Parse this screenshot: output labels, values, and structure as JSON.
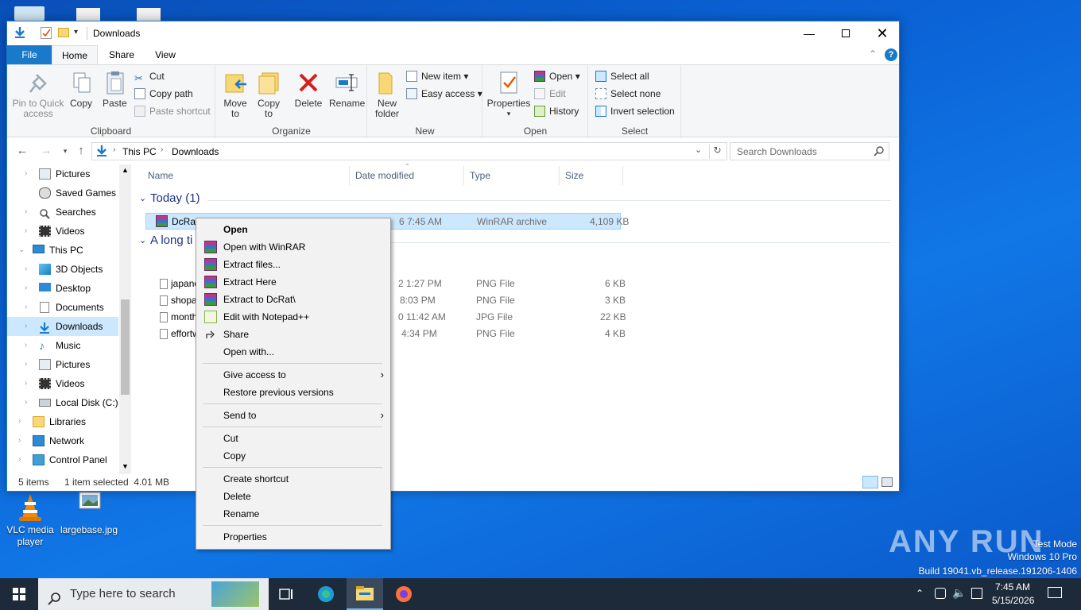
{
  "window": {
    "title": "Downloads",
    "tabs": [
      "File",
      "Home",
      "Share",
      "View"
    ]
  },
  "ribbon": {
    "clipboard": {
      "label": "Clipboard",
      "pin": "Pin to Quick access",
      "pin_l1": "Pin to Quick",
      "pin_l2": "access",
      "copy": "Copy",
      "paste": "Paste",
      "cut": "Cut",
      "copy_path": "Copy path",
      "paste_shortcut": "Paste shortcut"
    },
    "organize": {
      "label": "Organize",
      "move_to_l1": "Move",
      "move_to_l2": "to",
      "copy_to_l1": "Copy",
      "copy_to_l2": "to",
      "delete": "Delete",
      "rename": "Rename"
    },
    "new": {
      "label": "New",
      "new_folder_l1": "New",
      "new_folder_l2": "folder",
      "new_item": "New item",
      "easy_access": "Easy access"
    },
    "open": {
      "label": "Open",
      "properties": "Properties",
      "open": "Open",
      "edit": "Edit",
      "history": "History"
    },
    "select": {
      "label": "Select",
      "select_all": "Select all",
      "select_none": "Select none",
      "invert": "Invert selection"
    }
  },
  "address": {
    "crumbs": [
      "This PC",
      "Downloads"
    ],
    "search_placeholder": "Search Downloads"
  },
  "nav": [
    {
      "label": "Pictures",
      "icon": "pictures-icon"
    },
    {
      "label": "Saved Games",
      "icon": "saved-games-icon"
    },
    {
      "label": "Searches",
      "icon": "searches-icon"
    },
    {
      "label": "Videos",
      "icon": "videos-icon"
    },
    {
      "label": "This PC",
      "icon": "this-pc-icon"
    },
    {
      "label": "3D Objects",
      "icon": "3d-objects-icon"
    },
    {
      "label": "Desktop",
      "icon": "desktop-icon"
    },
    {
      "label": "Documents",
      "icon": "documents-icon"
    },
    {
      "label": "Downloads",
      "icon": "downloads-icon"
    },
    {
      "label": "Music",
      "icon": "music-icon"
    },
    {
      "label": "Pictures",
      "icon": "pictures-icon"
    },
    {
      "label": "Videos",
      "icon": "videos-icon"
    },
    {
      "label": "Local Disk (C:)",
      "icon": "disk-icon"
    },
    {
      "label": "Libraries",
      "icon": "libraries-icon"
    },
    {
      "label": "Network",
      "icon": "network-icon"
    },
    {
      "label": "Control Panel",
      "icon": "control-panel-icon"
    }
  ],
  "columns": {
    "name": "Name",
    "date": "Date modified",
    "type": "Type",
    "size": "Size"
  },
  "groups": {
    "today": "Today (1)",
    "longtime": "A long ti"
  },
  "files": [
    {
      "name": "DcRat.7",
      "date": "6 7:45 AM",
      "type": "WinRAR archive",
      "size": "4,109 KB"
    },
    {
      "name": "japanes",
      "date": "2 1:27 PM",
      "type": "PNG File",
      "size": "6 KB"
    },
    {
      "name": "shopad",
      "date": "8:03 PM",
      "type": "PNG File",
      "size": "3 KB"
    },
    {
      "name": "months",
      "date": "0 11:42 AM",
      "type": "JPG File",
      "size": "22 KB"
    },
    {
      "name": "effortw",
      "date": "4:34 PM",
      "type": "PNG File",
      "size": "4 KB"
    }
  ],
  "status": {
    "items": "5 items",
    "selected": "1 item selected  4.01 MB"
  },
  "context_menu": {
    "open": "Open",
    "open_winrar": "Open with WinRAR",
    "extract_files": "Extract files...",
    "extract_here": "Extract Here",
    "extract_to": "Extract to DcRat\\",
    "edit_notepad": "Edit with Notepad++",
    "share": "Share",
    "open_with": "Open with...",
    "give_access": "Give access to",
    "restore": "Restore previous versions",
    "send_to": "Send to",
    "cut": "Cut",
    "copy": "Copy",
    "create_shortcut": "Create shortcut",
    "delete": "Delete",
    "rename": "Rename",
    "properties": "Properties"
  },
  "desktop": {
    "vlc_l1": "VLC media",
    "vlc_l2": "player",
    "largebase": "largebase.jpg"
  },
  "taskbar": {
    "search_placeholder": "Type here to search",
    "time": "7:45 AM",
    "date": "5/15/2026"
  },
  "watermark": {
    "brand": "ANY RUN",
    "line1": "Test Mode",
    "line2": "Windows 10 Pro",
    "line3": "Build 19041.vb_release.191206-1406"
  },
  "colors": {
    "accent": "#1979ca",
    "selection": "#cce8ff",
    "taskbar": "#1c2a3a"
  }
}
